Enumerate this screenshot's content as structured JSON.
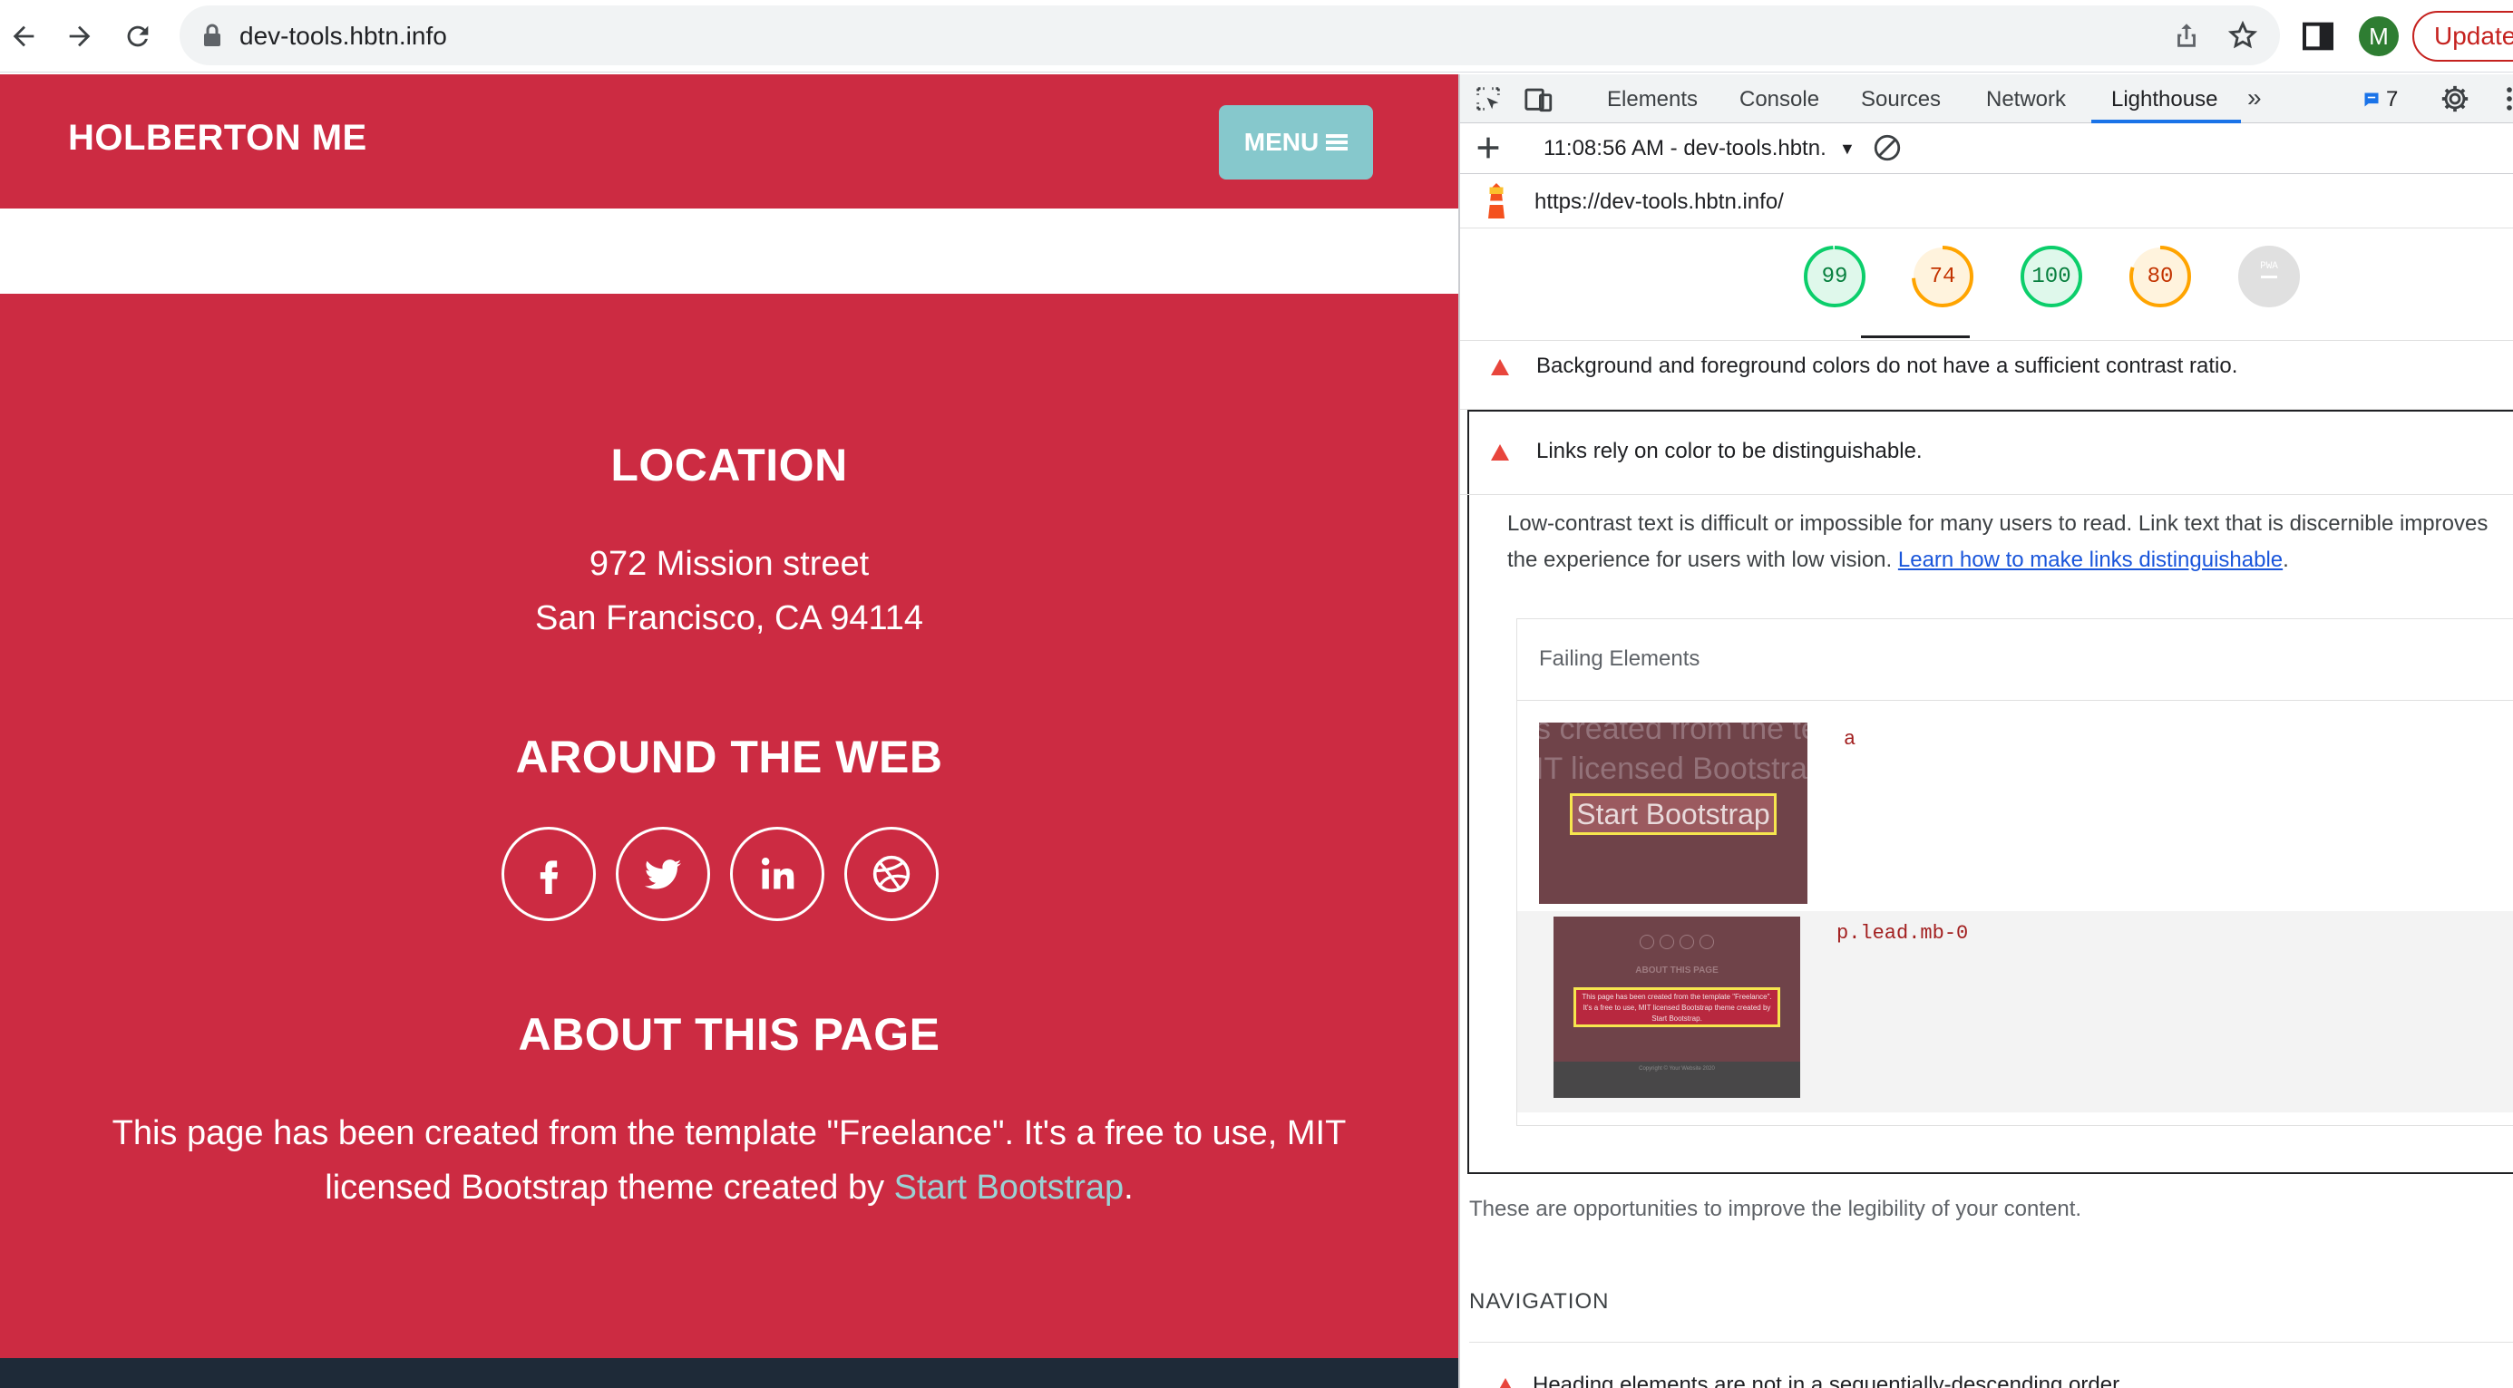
{
  "browser": {
    "url": "dev-tools.hbtn.info",
    "avatar_initial": "M",
    "update_label": "Update"
  },
  "site": {
    "brand": "HOLBERTON ME",
    "menu_label": "MENU",
    "location_title": "LOCATION",
    "address_line1": "972 Mission street",
    "address_line2": "San Francisco, CA 94114",
    "web_title": "AROUND THE WEB",
    "social_icons": [
      "facebook-icon",
      "twitter-icon",
      "linkedin-icon",
      "dribbble-icon"
    ],
    "about_title": "ABOUT THIS PAGE",
    "about_text_before": "This page has been created from the template \"Freelance\". It's a free to use, MIT licensed Bootstrap theme created by ",
    "about_link": "Start Bootstrap",
    "about_text_after": "."
  },
  "devtools": {
    "tabs": [
      "Elements",
      "Console",
      "Sources",
      "Network",
      "Lighthouse"
    ],
    "active_tab": "Lighthouse",
    "issues_count": "7",
    "report_select": "11:08:56 AM - dev-tools.hbtn.",
    "report_url": "https://dev-tools.hbtn.info/",
    "scores": [
      {
        "value": "99",
        "fraction": 0.99,
        "color": "#0cce6b",
        "text_color": "#08803f"
      },
      {
        "value": "74",
        "fraction": 0.74,
        "color": "#ffa400",
        "text_color": "#c33300"
      },
      {
        "value": "100",
        "fraction": 1.0,
        "color": "#0cce6b",
        "text_color": "#08803f"
      },
      {
        "value": "80",
        "fraction": 0.8,
        "color": "#ffa400",
        "text_color": "#c33300"
      },
      {
        "value": "PWA",
        "fraction": 0,
        "color": "#bdbdbd",
        "text_color": "#bdbdbd"
      }
    ],
    "audit_contrast": "Background and foreground colors do not have a sufficient contrast ratio.",
    "audit_links": "Links rely on color to be distinguishable.",
    "desc_line1": "Low-contrast text is difficult or impossible for many users to read. Link text that is discernible improves",
    "desc_line2_before": "the experience for users with low vision. ",
    "desc_link": "Learn how to make links distinguishable",
    "desc_line2_after": ".",
    "failing_header": "Failing Elements",
    "failing": [
      {
        "selector": "a",
        "thumb_text_1": "s created from the te",
        "thumb_text_2": "IT licensed Bootstra",
        "thumb_highlight": "Start Bootstrap"
      },
      {
        "selector": "p.lead.mb-0",
        "thumb_heading": "ABOUT THIS PAGE",
        "thumb_highlight": "This page has been created from the template \"Freelance\". It's a free to use, MIT licensed Bootstrap theme created by Start Bootstrap.",
        "thumb_footer": "Copyright © Your Website 2020"
      }
    ],
    "opportunities_text": "These are opportunities to improve the legibility of your content.",
    "navigation_heading": "NAVIGATION",
    "heading_audit": "Heading elements are not in a sequentially-descending order"
  }
}
